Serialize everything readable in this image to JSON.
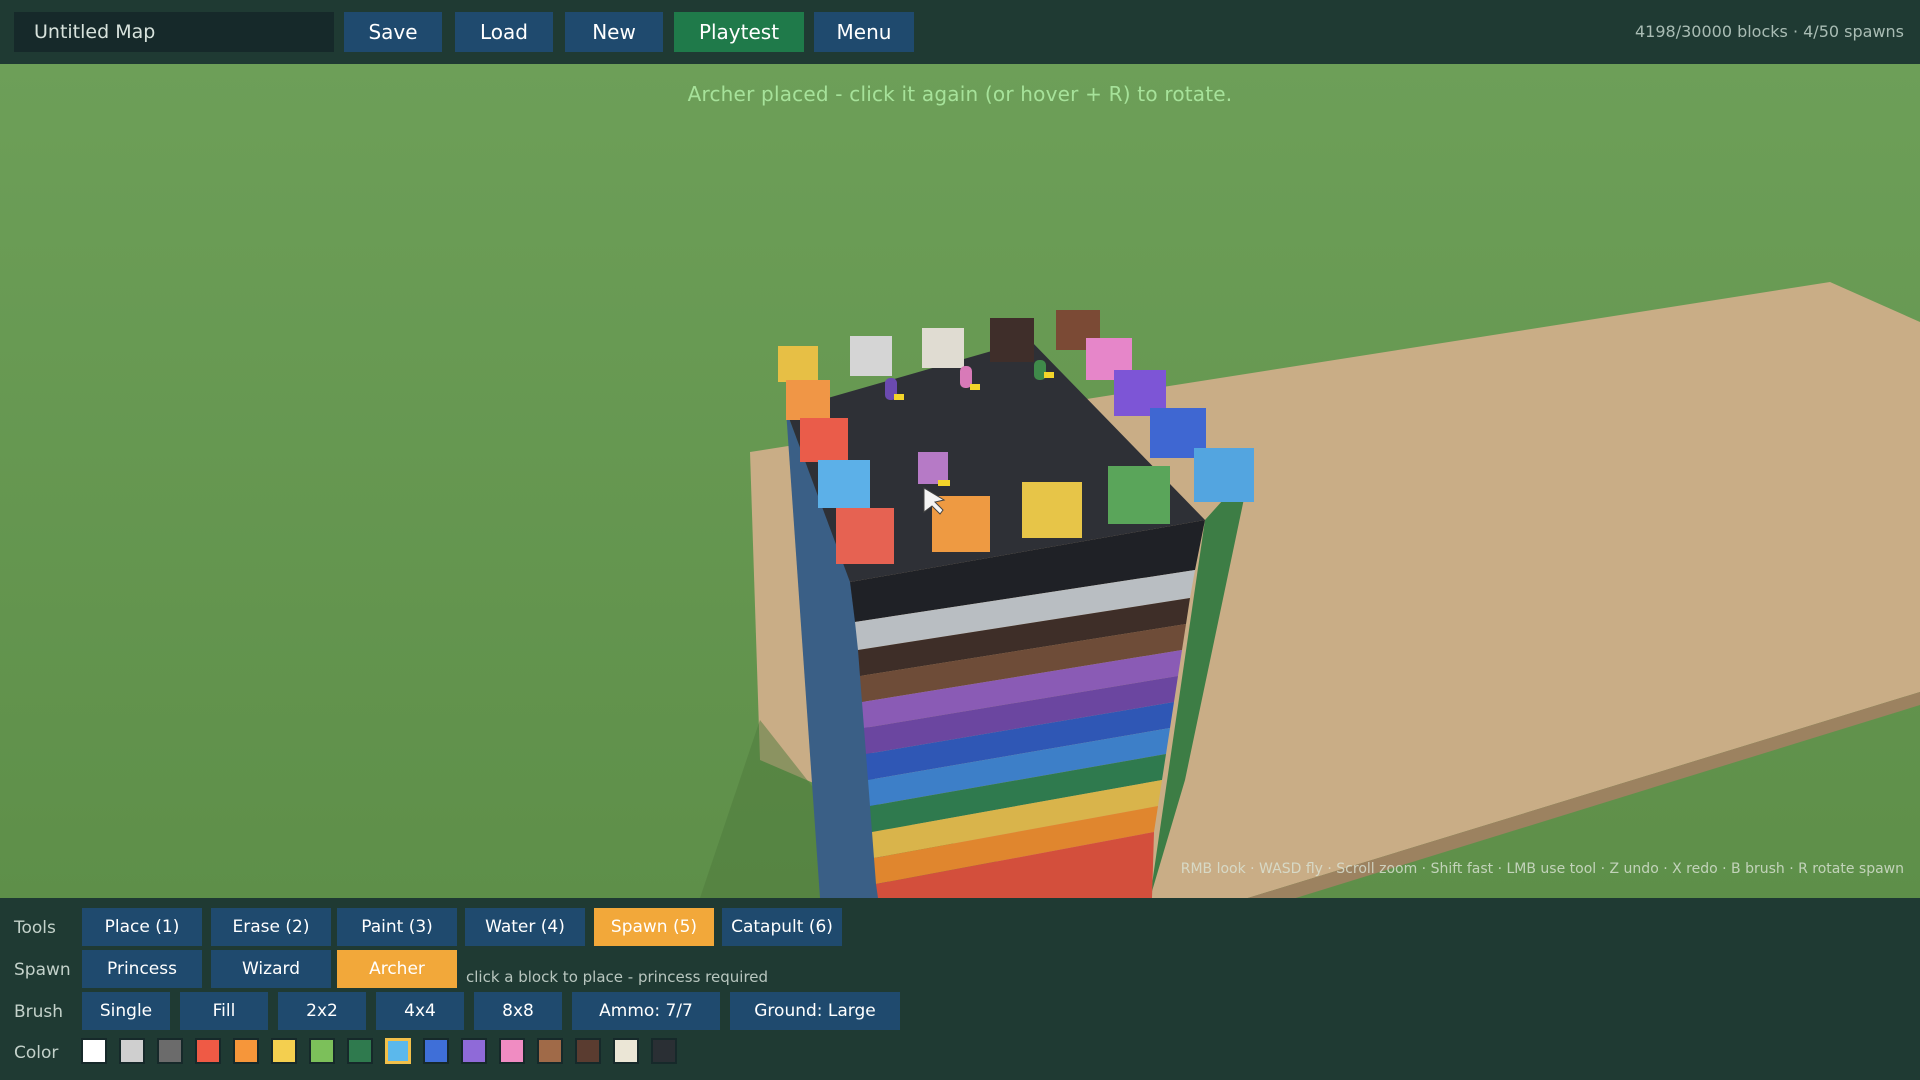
{
  "topbar": {
    "map_name": "Untitled Map",
    "buttons": {
      "save": "Save",
      "load": "Load",
      "new": "New",
      "playtest": "Playtest",
      "menu": "Menu"
    },
    "counts": "4198/30000 blocks · 4/50 spawns"
  },
  "status_message": "Archer placed - click it again (or hover + R) to rotate.",
  "controls_hint": "RMB look · WASD fly · Scroll zoom · Shift fast · LMB use tool · Z undo · X redo · B brush · R rotate spawn",
  "panel": {
    "tools": {
      "label": "Tools",
      "items": [
        "Place (1)",
        "Erase (2)",
        "Paint (3)",
        "Water (4)",
        "Spawn (5)",
        "Catapult (6)"
      ],
      "selected": "Spawn (5)"
    },
    "spawn": {
      "label": "Spawn",
      "items": [
        "Princess",
        "Wizard",
        "Archer"
      ],
      "selected": "Archer",
      "note": "click a block to place - princess required"
    },
    "brush": {
      "label": "Brush",
      "items": [
        "Single",
        "Fill",
        "2x2",
        "4x4",
        "8x8"
      ],
      "ammo": "Ammo: 7/7",
      "ground": "Ground: Large"
    },
    "color": {
      "label": "Color",
      "swatches": [
        "#ffffff",
        "#cfcfcf",
        "#6b6b6b",
        "#ef5a45",
        "#f6963a",
        "#f4cf4f",
        "#7cc05a",
        "#2f7a4e",
        "#5bb8ec",
        "#3f6fd8",
        "#8f6ad8",
        "#f08cc2",
        "#a06a48",
        "#5a3c30",
        "#ebe6d6",
        "#2a2f34"
      ],
      "selected_index": 8
    }
  }
}
